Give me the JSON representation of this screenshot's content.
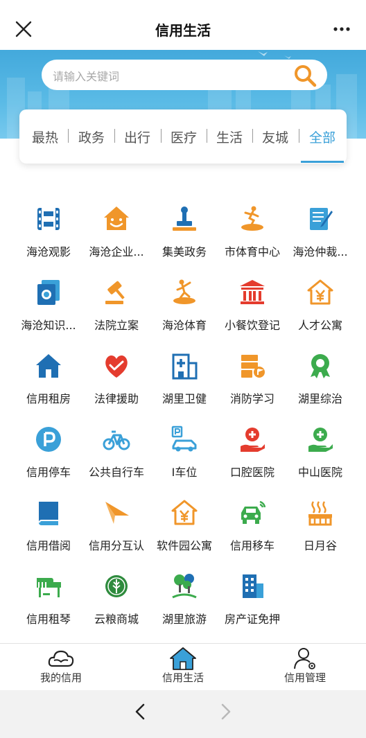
{
  "header": {
    "title": "信用生活"
  },
  "search": {
    "placeholder": "请输入关键词"
  },
  "tabs": [
    {
      "label": "最热",
      "active": false
    },
    {
      "label": "政务",
      "active": false
    },
    {
      "label": "出行",
      "active": false
    },
    {
      "label": "医疗",
      "active": false
    },
    {
      "label": "生活",
      "active": false
    },
    {
      "label": "友城",
      "active": false
    },
    {
      "label": "全部",
      "active": true
    }
  ],
  "grid": [
    {
      "label": "海沧观影",
      "icon": "film-icon"
    },
    {
      "label": "海沧企业...",
      "icon": "smile-house-icon"
    },
    {
      "label": "集美政务",
      "icon": "stamp-icon"
    },
    {
      "label": "市体育中心",
      "icon": "runner-icon"
    },
    {
      "label": "海沧仲裁...",
      "icon": "notebook-pen-icon"
    },
    {
      "label": "海沧知识...",
      "icon": "documents-icon"
    },
    {
      "label": "法院立案",
      "icon": "gavel-icon"
    },
    {
      "label": "海沧体育",
      "icon": "dancer-icon"
    },
    {
      "label": "小餐饮登记",
      "icon": "government-building-icon"
    },
    {
      "label": "人才公寓",
      "icon": "yen-house-icon"
    },
    {
      "label": "信用租房",
      "icon": "house-icon"
    },
    {
      "label": "法律援助",
      "icon": "heart-hands-icon"
    },
    {
      "label": "湖里卫健",
      "icon": "hospital-building-icon"
    },
    {
      "label": "消防学习",
      "icon": "fire-station-icon"
    },
    {
      "label": "湖里综治",
      "icon": "award-badge-icon"
    },
    {
      "label": "信用停车",
      "icon": "parking-icon"
    },
    {
      "label": "公共自行车",
      "icon": "bicycle-icon"
    },
    {
      "label": "I车位",
      "icon": "parking-car-icon"
    },
    {
      "label": "口腔医院",
      "icon": "medical-hand-icon"
    },
    {
      "label": "中山医院",
      "icon": "medical-hand-green-icon"
    },
    {
      "label": "信用借阅",
      "icon": "book-icon"
    },
    {
      "label": "信用分互认",
      "icon": "paper-plane-icon"
    },
    {
      "label": "软件园公寓",
      "icon": "yen-house-icon"
    },
    {
      "label": "信用移车",
      "icon": "car-signal-icon"
    },
    {
      "label": "日月谷",
      "icon": "hot-spring-icon"
    },
    {
      "label": "信用租琴",
      "icon": "piano-icon"
    },
    {
      "label": "云粮商城",
      "icon": "grain-icon"
    },
    {
      "label": "湖里旅游",
      "icon": "trees-icon"
    },
    {
      "label": "房产证免押",
      "icon": "office-building-icon"
    }
  ],
  "bottom_nav": [
    {
      "label": "我的信用",
      "icon": "cloud-hand-icon"
    },
    {
      "label": "信用生活",
      "icon": "home-icon",
      "active": true
    },
    {
      "label": "信用管理",
      "icon": "user-gear-icon"
    }
  ],
  "colors": {
    "accent_blue": "#3aa0d8",
    "orange": "#f0962a",
    "red": "#e43c2e",
    "green": "#3cab4d",
    "blue_dark": "#1f6fb3"
  }
}
